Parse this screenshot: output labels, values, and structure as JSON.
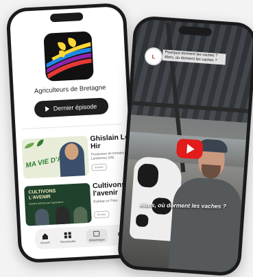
{
  "left_phone": {
    "app_title": "Agriculteurs de Bretagne",
    "latest_episode_label": "Dernier épisode",
    "episodes": [
      {
        "thumb_text": "MA VIE D'AGRI",
        "title": "Ghislain Le Hir",
        "subtitle": "Producteur de tomates à Landunvez (29)",
        "tag": "Écoutez"
      },
      {
        "thumb_text": "CULTIVONS L'AVENIR",
        "thumb_sub": "Experts animés par l'agriculture",
        "title": "Cultivons l'avenir",
        "subtitle": "Esteban et Théo",
        "tag": "Écoutez"
      }
    ],
    "nav": [
      {
        "label": "Accueil",
        "icon": "home-icon"
      },
      {
        "label": "Nouveautés",
        "icon": "grid-icon"
      },
      {
        "label": "Bibliothèque",
        "icon": "library-icon"
      },
      {
        "label": "",
        "icon": "search-icon"
      }
    ]
  },
  "right_phone": {
    "channel_badge": "L",
    "top_caption": "Pourquoi dorment les vaches ? Alors, où dorment les vaches ?",
    "subtitle": "Alors, où dorment les vaches ?"
  },
  "colors": {
    "accent_red": "#e21b1b",
    "dark": "#1e1e1e",
    "green": "#20412c"
  }
}
